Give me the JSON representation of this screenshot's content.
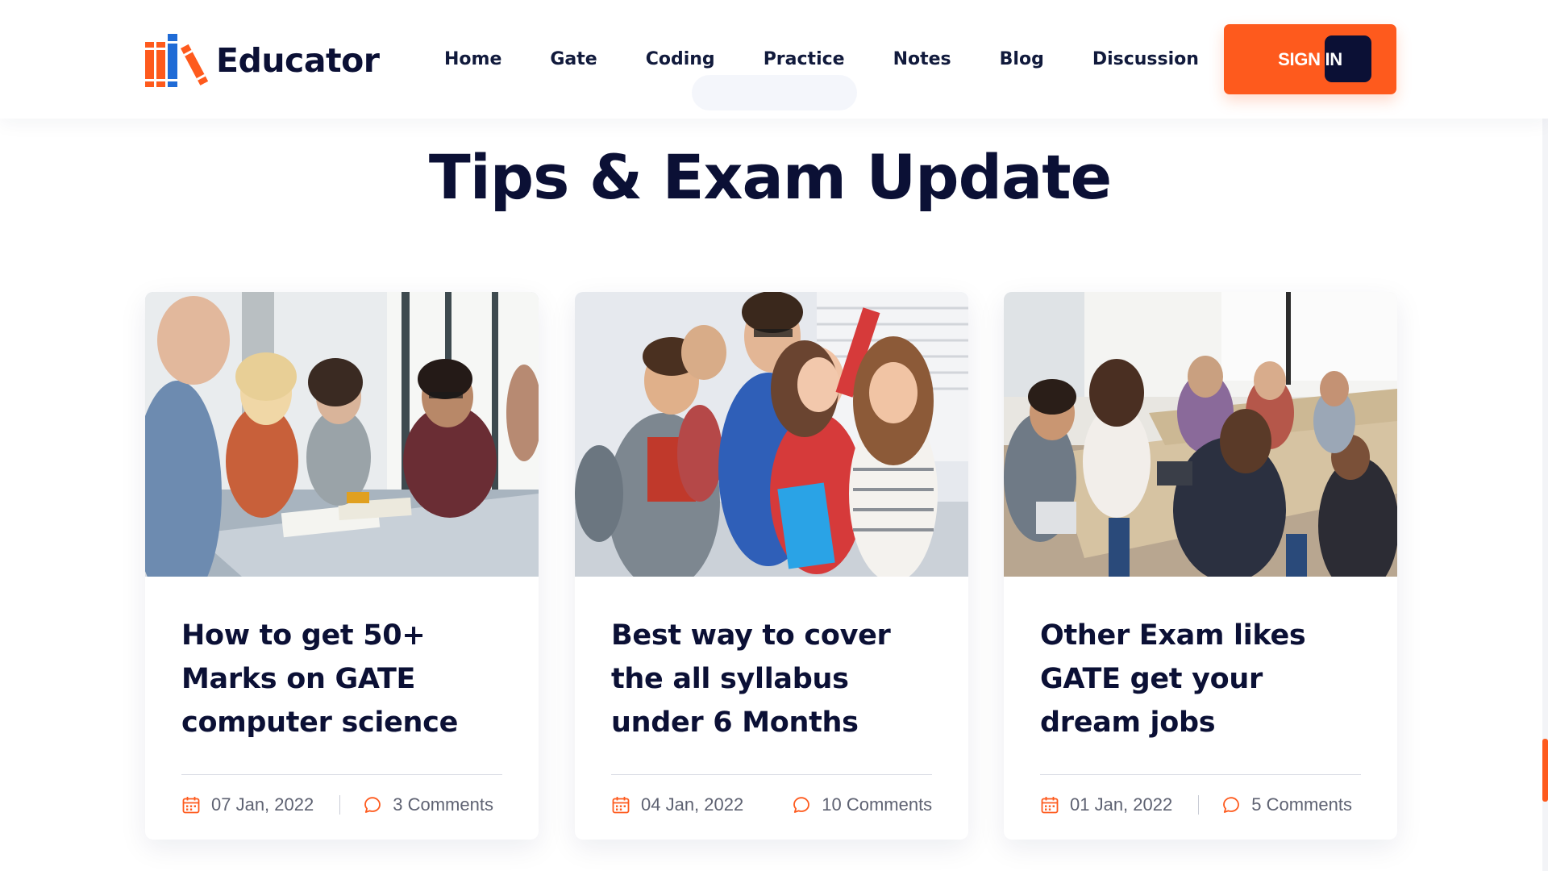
{
  "header": {
    "brand": "Educator",
    "nav": [
      "Home",
      "Gate",
      "Coding",
      "Practice",
      "Notes",
      "Blog",
      "Discussion"
    ],
    "signin_label": "SIGN IN"
  },
  "section": {
    "title": "Tips & Exam Update"
  },
  "cards": [
    {
      "title": "How to get 50+ Marks on GATE computer science",
      "date": "07 Jan, 2022",
      "comments": "3 Comments",
      "image": "students studying at library table"
    },
    {
      "title": "Best way to cover the all syllabus under 6 Months",
      "date": "04 Jan, 2022",
      "comments": "10 Comments",
      "image": "cheerful group of students with folders"
    },
    {
      "title": "Other Exam likes GATE get your dream jobs",
      "date": "01 Jan, 2022",
      "comments": "5 Comments",
      "image": "students writing in classroom"
    }
  ],
  "colors": {
    "accent": "#fe5a1d",
    "navy": "#0b1035",
    "logo_blue": "#1f6bd6",
    "meta_text": "#5e6272"
  },
  "icons": {
    "date": "calendar-icon",
    "comments": "comment-bubble-icon"
  }
}
